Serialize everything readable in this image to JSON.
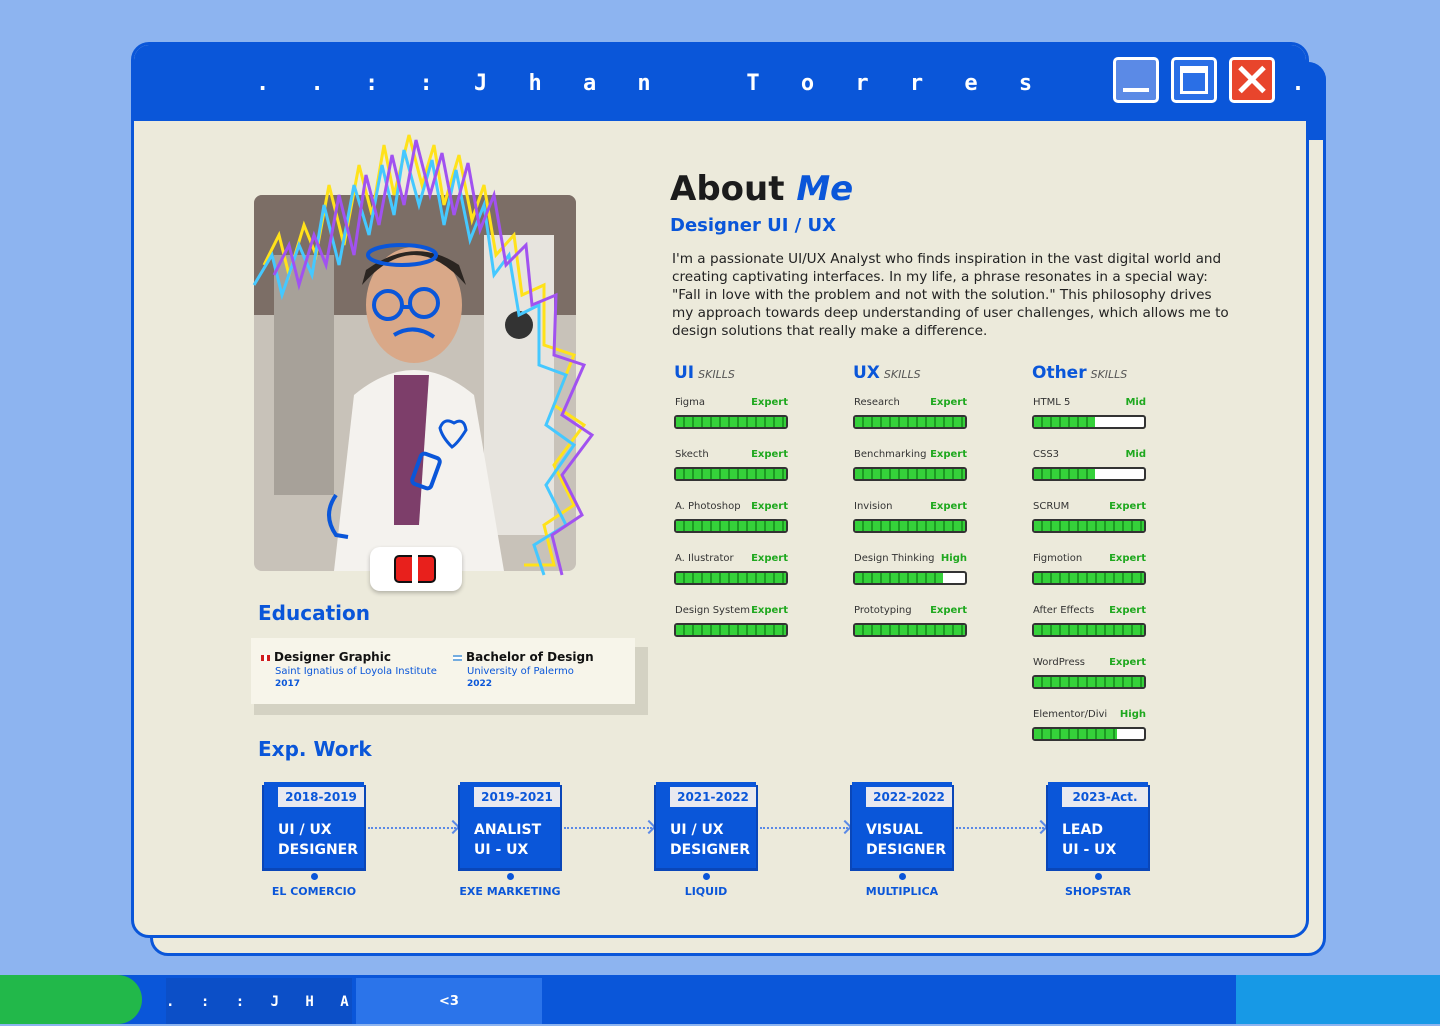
{
  "window": {
    "title": ". . : : J h a n   T o r r e s   : : . ."
  },
  "about": {
    "title_plain": "About",
    "title_accent": "Me",
    "subtitle": "Designer UI / UX",
    "text": "I'm a passionate UI/UX Analyst who finds inspiration in the vast digital world and creating captivating interfaces. In my life, a phrase resonates in a special way: \"Fall in love with the problem and not with the solution.\" This philosophy drives my approach towards deep understanding of user challenges, which allows me to design solutions that really make a difference."
  },
  "skills": {
    "ui": {
      "title": "UI",
      "suffix": "SKILLS",
      "items": [
        {
          "name": "Figma",
          "level": "Expert",
          "value": 100
        },
        {
          "name": "Skecth",
          "level": "Expert",
          "value": 100
        },
        {
          "name": "A. Photoshop",
          "level": "Expert",
          "value": 100
        },
        {
          "name": "A. Ilustrator",
          "level": "Expert",
          "value": 100
        },
        {
          "name": "Design System",
          "level": "Expert",
          "value": 100
        }
      ]
    },
    "ux": {
      "title": "UX",
      "suffix": "SKILLS",
      "items": [
        {
          "name": "Research",
          "level": "Expert",
          "value": 100
        },
        {
          "name": "Benchmarking",
          "level": "Expert",
          "value": 100
        },
        {
          "name": "Invision",
          "level": "Expert",
          "value": 100
        },
        {
          "name": "Design Thinking",
          "level": "High",
          "value": 80
        },
        {
          "name": "Prototyping",
          "level": "Expert",
          "value": 100
        }
      ]
    },
    "other": {
      "title": "Other",
      "suffix": "SKILLS",
      "items": [
        {
          "name": "HTML 5",
          "level": "Mid",
          "value": 55
        },
        {
          "name": "CSS3",
          "level": "Mid",
          "value": 55
        },
        {
          "name": "SCRUM",
          "level": "Expert",
          "value": 100
        },
        {
          "name": "Figmotion",
          "level": "Expert",
          "value": 100
        },
        {
          "name": "After Effects",
          "level": "Expert",
          "value": 100
        },
        {
          "name": "WordPress",
          "level": "Expert",
          "value": 100
        },
        {
          "name": "Elementor/Divi",
          "level": "High",
          "value": 75
        }
      ]
    }
  },
  "education": {
    "title": "Education",
    "items": [
      {
        "degree": "Designer Graphic",
        "school": "Saint Ignatius of Loyola Institute",
        "year": "2017"
      },
      {
        "degree": "Bachelor of Design",
        "school": "University of Palermo",
        "year": "2022"
      }
    ]
  },
  "work": {
    "title": "Exp. Work",
    "items": [
      {
        "years": "2018-2019",
        "role_line1": "UI / UX",
        "role_line2": "DESIGNER",
        "company": "EL COMERCIO"
      },
      {
        "years": "2019-2021",
        "role_line1": "ANALIST",
        "role_line2": "UI - UX",
        "company": "EXE MARKETING"
      },
      {
        "years": "2021-2022",
        "role_line1": "UI / UX",
        "role_line2": "DESIGNER",
        "company": "LIQUID"
      },
      {
        "years": "2022-2022",
        "role_line1": "VISUAL",
        "role_line2": "DESIGNER",
        "company": "MULTIPLICA"
      },
      {
        "years": "2023-Act.",
        "role_line1": "LEAD",
        "role_line2": "UI - UX",
        "company": "SHOPSTAR"
      }
    ]
  },
  "taskbar": {
    "item1": ". : : J H A N",
    "item2": "<3"
  },
  "colors": {
    "primary": "#0a56d9",
    "background": "#8db4f0",
    "panel": "#eceadb",
    "skill_level": "#1fa81f",
    "close": "#e8452c",
    "start": "#22b84a"
  },
  "icons": [
    "minimize-icon",
    "maximize-icon",
    "close-icon",
    "flag-peru-icon",
    "flag-argentina-icon",
    "sticker-icon"
  ]
}
